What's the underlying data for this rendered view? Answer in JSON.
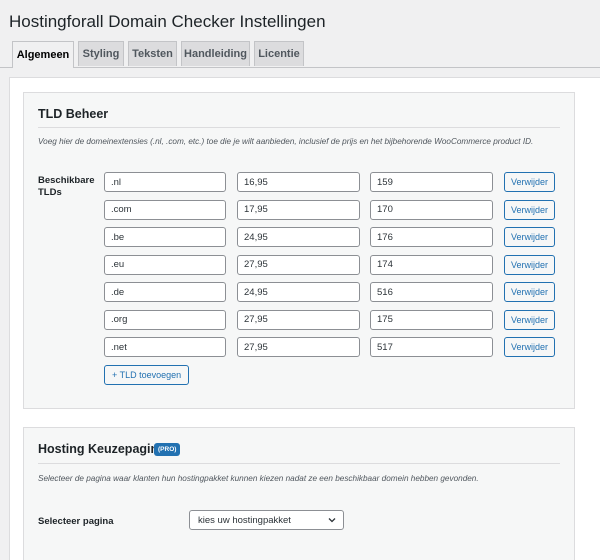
{
  "page": {
    "title": "Hostingforall Domain Checker Instellingen"
  },
  "tabs": [
    {
      "label": "Algemeen",
      "active": true
    },
    {
      "label": "Styling",
      "active": false
    },
    {
      "label": "Teksten",
      "active": false
    },
    {
      "label": "Handleiding",
      "active": false
    },
    {
      "label": "Licentie",
      "active": false
    }
  ],
  "tld_section": {
    "title": "TLD Beheer",
    "description": "Voeg hier de domeinextensies (.nl, .com, etc.) toe die je wilt aanbieden, inclusief de prijs en het bijbehorende WooCommerce product ID.",
    "label": "Beschikbare TLDs",
    "rows": [
      {
        "tld": ".nl",
        "price": "16,95",
        "product_id": "159"
      },
      {
        "tld": ".com",
        "price": "17,95",
        "product_id": "170"
      },
      {
        "tld": ".be",
        "price": "24,95",
        "product_id": "176"
      },
      {
        "tld": ".eu",
        "price": "27,95",
        "product_id": "174"
      },
      {
        "tld": ".de",
        "price": "24,95",
        "product_id": "516"
      },
      {
        "tld": ".org",
        "price": "27,95",
        "product_id": "175"
      },
      {
        "tld": ".net",
        "price": "27,95",
        "product_id": "517"
      }
    ],
    "remove_label": "Verwijder",
    "add_label": "+ TLD toevoegen"
  },
  "hosting_section": {
    "title": "Hosting Keuzepagina",
    "badge": "(PRO)",
    "description": "Selecteer de pagina waar klanten hun hostingpakket kunnen kiezen nadat ze een beschikbaar domein hebben gevonden.",
    "select_label": "Selecteer pagina",
    "select_value": "kies uw hostingpakket"
  },
  "colors": {
    "accent": "#2271b1",
    "background": "#f0f0f1",
    "card": "#f6f7f7",
    "border": "#dcdcde"
  }
}
